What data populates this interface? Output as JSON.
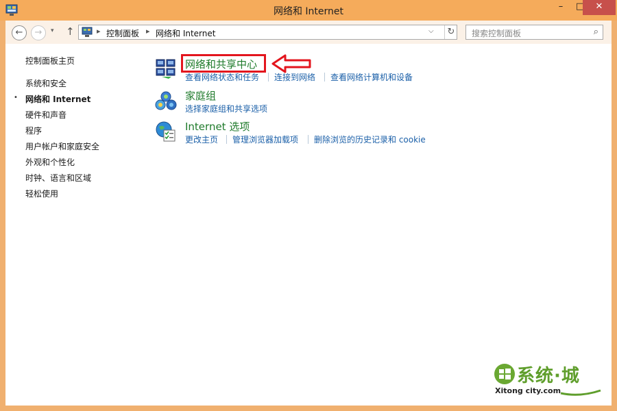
{
  "window": {
    "title": "网络和 Internet",
    "minimize": "–",
    "maximize": "□",
    "close": "✕"
  },
  "navigation": {
    "back": "←",
    "forward": "→",
    "recent": "▾",
    "up": "↑"
  },
  "address_bar": {
    "separator": "▸",
    "crumbs": [
      "控制面板",
      "网络和 Internet"
    ],
    "dropdown": "⌵",
    "refresh": "↻"
  },
  "search": {
    "placeholder": "搜索控制面板",
    "icon": "⌕"
  },
  "sidebar": {
    "home": "控制面板主页",
    "items": [
      {
        "label": "系统和安全",
        "current": false
      },
      {
        "label": "网络和 Internet",
        "current": true
      },
      {
        "label": "硬件和声音",
        "current": false
      },
      {
        "label": "程序",
        "current": false
      },
      {
        "label": "用户帐户和家庭安全",
        "current": false
      },
      {
        "label": "外观和个性化",
        "current": false
      },
      {
        "label": "时钟、语言和区域",
        "current": false
      },
      {
        "label": "轻松使用",
        "current": false
      }
    ],
    "bullet": "•"
  },
  "categories": [
    {
      "title": "网络和共享中心",
      "icon": "network-sharing-center-icon",
      "links": [
        "查看网络状态和任务",
        "连接到网络",
        "查看网络计算机和设备"
      ]
    },
    {
      "title": "家庭组",
      "icon": "homegroup-icon",
      "links": [
        "选择家庭组和共享选项"
      ]
    },
    {
      "title": "Internet 选项",
      "icon": "internet-options-icon",
      "links": [
        "更改主页",
        "管理浏览器加载项",
        "删除浏览的历史记录和 cookie"
      ]
    }
  ],
  "annotation": {
    "highlight_color": "#e3151d"
  },
  "watermark": {
    "brand": "系统·城",
    "site": "Xitong city.com"
  },
  "colors": {
    "frame": "#f5ab5b",
    "category_title": "#1e7a2a",
    "link": "#1a5fa8"
  }
}
